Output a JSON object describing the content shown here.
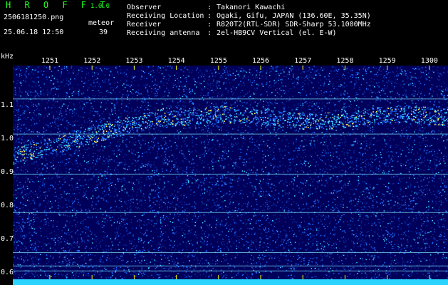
{
  "header": {
    "app_title": "H R O F F T",
    "app_version": "1.0.0",
    "file_name": "2506181250.png",
    "timestamp": "25.06.18 12:50",
    "meteor_label": "meteor",
    "meteor_count": "39"
  },
  "info": [
    {
      "key": "Observer",
      "value": "Takanori Kawachi"
    },
    {
      "key": "Receiving Location",
      "value": "Ogaki, Gifu, JAPAN (136.60E, 35.35N)"
    },
    {
      "key": "Receiver",
      "value": "R820T2(RTL-SDR) SDR-Sharp 53.1000MHz"
    },
    {
      "key": "Receiving antenna",
      "value": "2el-HB9CV Vertical (el. E-W)"
    }
  ],
  "info_separator": ":",
  "spectrogram": {
    "y_unit": "kHz",
    "time_ticks": [
      "1251",
      "1252",
      "1253",
      "1254",
      "1255",
      "1256",
      "1257",
      "1258",
      "1259",
      "1300"
    ],
    "freq_ticks": [
      {
        "label": "1.1",
        "value": 1.1
      },
      {
        "label": "1.0",
        "value": 1.0
      },
      {
        "label": "0.9",
        "value": 0.9
      },
      {
        "label": "0.8",
        "value": 0.8
      },
      {
        "label": "0.7",
        "value": 0.7
      },
      {
        "label": "0.6",
        "value": 0.6
      }
    ],
    "freq_range": [
      0.58,
      1.22
    ],
    "colors": {
      "background": "#00005a",
      "noise_low": "#0a2a9a",
      "noise_mid": "#1c6bff",
      "noise_high": "#39d3ff",
      "carrier": "#7fe8ff",
      "tick": "#ffff00",
      "bottom_band": "#2ad4ff"
    }
  }
}
